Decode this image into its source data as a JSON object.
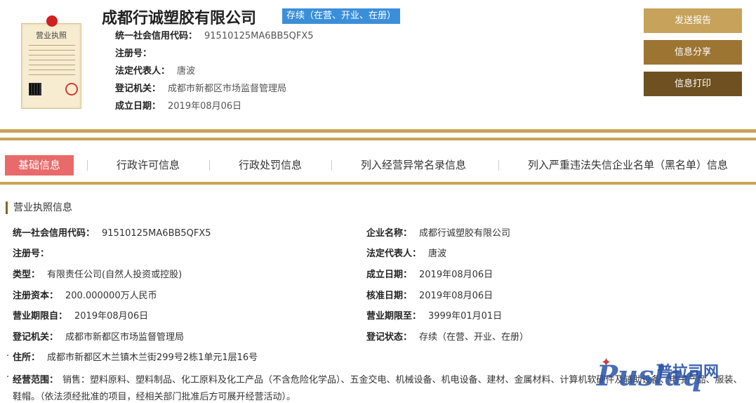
{
  "header": {
    "company_name": "成都行诚塑胶有限公司",
    "status_badge": "存续（在营、开业、在册）",
    "license_thumb_title": "营业执照",
    "rows": [
      {
        "label": "统一社会信用代码：",
        "value": "91510125MA6BB5QFX5"
      },
      {
        "label": "注册号：",
        "value": ""
      },
      {
        "label": "法定代表人：",
        "value": "唐波"
      },
      {
        "label": "登记机关：",
        "value": "成都市新都区市场监督管理局"
      },
      {
        "label": "成立日期：",
        "value": "2019年08月06日"
      }
    ]
  },
  "actions": {
    "send_report": "发送报告",
    "share_info": "信息分享",
    "print_info": "信息打印"
  },
  "tabs": [
    {
      "label": "基础信息",
      "active": true
    },
    {
      "label": "行政许可信息",
      "active": false
    },
    {
      "label": "行政处罚信息",
      "active": false
    },
    {
      "label": "列入经营异常名录信息",
      "active": false
    },
    {
      "label": "列入严重违法失信企业名单（黑名单）信息",
      "active": false
    }
  ],
  "section": {
    "title": "营业执照信息",
    "left": [
      {
        "label": "统一社会信用代码：",
        "value": "91510125MA6BB5QFX5"
      },
      {
        "label": "注册号：",
        "value": ""
      },
      {
        "label": "类型：",
        "value": "有限责任公司(自然人投资或控股)"
      },
      {
        "label": "注册资本：",
        "value": "200.000000万人民币"
      },
      {
        "label": "营业期限自：",
        "value": "2019年08月06日"
      },
      {
        "label": "登记机关：",
        "value": "成都市新都区市场监督管理局"
      }
    ],
    "right": [
      {
        "label": "企业名称：",
        "value": "成都行诚塑胶有限公司"
      },
      {
        "label": "法定代表人：",
        "value": "唐波"
      },
      {
        "label": "成立日期：",
        "value": "2019年08月06日"
      },
      {
        "label": "核准日期：",
        "value": "2019年08月06日"
      },
      {
        "label": "营业期限至：",
        "value": "3999年01月01日"
      },
      {
        "label": "登记状态：",
        "value": "存续（在营、开业、在册）"
      }
    ],
    "address": {
      "label": "住所：",
      "value": "成都市新都区木兰镇木兰街299号2栋1单元1层16号"
    },
    "scope": {
      "label": "经营范围：",
      "value": "销售：塑料原料、塑料制品、化工原料及化工产品（不含危险化学品）、五金交电、机械设备、机电设备、建材、金属材料、计算机软硬件及辅助设备、电子产品、服装、鞋帽。（依法须经批准的项目，经相关部门批准后方可展开经营活动）。"
    }
  },
  "watermark": {
    "latin": "Puslaq",
    "cn": "普拉司网"
  },
  "colors": {
    "gold": "#c9a456",
    "badge_blue": "#3b8fd9",
    "tab_active": "#e86a6a",
    "btn_send": "#c7a25a",
    "btn_share": "#9d7533",
    "btn_print": "#6e5021"
  }
}
